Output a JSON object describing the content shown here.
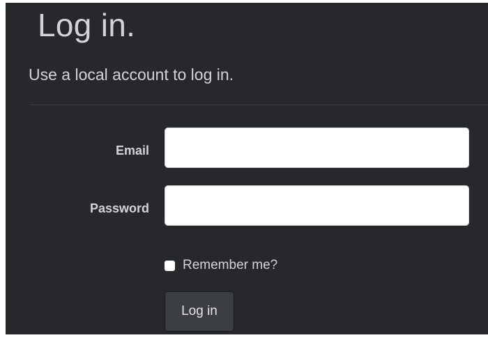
{
  "page": {
    "title": "Log in.",
    "subtitle": "Use a local account to log in."
  },
  "form": {
    "email": {
      "label": "Email",
      "value": "",
      "placeholder": ""
    },
    "password": {
      "label": "Password",
      "value": "",
      "placeholder": ""
    },
    "remember": {
      "label": "Remember me?",
      "checked": false
    },
    "submit_label": "Log in"
  },
  "colors": {
    "background": "#26282c",
    "text": "#d3d4d6",
    "button": "#3a3d42"
  }
}
